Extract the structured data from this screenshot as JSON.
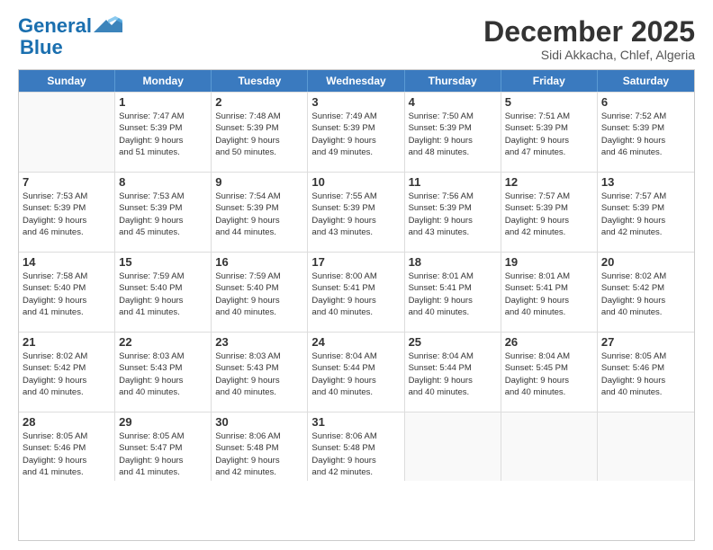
{
  "logo": {
    "line1": "General",
    "line2": "Blue"
  },
  "title": "December 2025",
  "location": "Sidi Akkacha, Chlef, Algeria",
  "days_of_week": [
    "Sunday",
    "Monday",
    "Tuesday",
    "Wednesday",
    "Thursday",
    "Friday",
    "Saturday"
  ],
  "weeks": [
    [
      {
        "num": "",
        "lines": []
      },
      {
        "num": "1",
        "lines": [
          "Sunrise: 7:47 AM",
          "Sunset: 5:39 PM",
          "Daylight: 9 hours",
          "and 51 minutes."
        ]
      },
      {
        "num": "2",
        "lines": [
          "Sunrise: 7:48 AM",
          "Sunset: 5:39 PM",
          "Daylight: 9 hours",
          "and 50 minutes."
        ]
      },
      {
        "num": "3",
        "lines": [
          "Sunrise: 7:49 AM",
          "Sunset: 5:39 PM",
          "Daylight: 9 hours",
          "and 49 minutes."
        ]
      },
      {
        "num": "4",
        "lines": [
          "Sunrise: 7:50 AM",
          "Sunset: 5:39 PM",
          "Daylight: 9 hours",
          "and 48 minutes."
        ]
      },
      {
        "num": "5",
        "lines": [
          "Sunrise: 7:51 AM",
          "Sunset: 5:39 PM",
          "Daylight: 9 hours",
          "and 47 minutes."
        ]
      },
      {
        "num": "6",
        "lines": [
          "Sunrise: 7:52 AM",
          "Sunset: 5:39 PM",
          "Daylight: 9 hours",
          "and 46 minutes."
        ]
      }
    ],
    [
      {
        "num": "7",
        "lines": [
          "Sunrise: 7:53 AM",
          "Sunset: 5:39 PM",
          "Daylight: 9 hours",
          "and 46 minutes."
        ]
      },
      {
        "num": "8",
        "lines": [
          "Sunrise: 7:53 AM",
          "Sunset: 5:39 PM",
          "Daylight: 9 hours",
          "and 45 minutes."
        ]
      },
      {
        "num": "9",
        "lines": [
          "Sunrise: 7:54 AM",
          "Sunset: 5:39 PM",
          "Daylight: 9 hours",
          "and 44 minutes."
        ]
      },
      {
        "num": "10",
        "lines": [
          "Sunrise: 7:55 AM",
          "Sunset: 5:39 PM",
          "Daylight: 9 hours",
          "and 43 minutes."
        ]
      },
      {
        "num": "11",
        "lines": [
          "Sunrise: 7:56 AM",
          "Sunset: 5:39 PM",
          "Daylight: 9 hours",
          "and 43 minutes."
        ]
      },
      {
        "num": "12",
        "lines": [
          "Sunrise: 7:57 AM",
          "Sunset: 5:39 PM",
          "Daylight: 9 hours",
          "and 42 minutes."
        ]
      },
      {
        "num": "13",
        "lines": [
          "Sunrise: 7:57 AM",
          "Sunset: 5:39 PM",
          "Daylight: 9 hours",
          "and 42 minutes."
        ]
      }
    ],
    [
      {
        "num": "14",
        "lines": [
          "Sunrise: 7:58 AM",
          "Sunset: 5:40 PM",
          "Daylight: 9 hours",
          "and 41 minutes."
        ]
      },
      {
        "num": "15",
        "lines": [
          "Sunrise: 7:59 AM",
          "Sunset: 5:40 PM",
          "Daylight: 9 hours",
          "and 41 minutes."
        ]
      },
      {
        "num": "16",
        "lines": [
          "Sunrise: 7:59 AM",
          "Sunset: 5:40 PM",
          "Daylight: 9 hours",
          "and 40 minutes."
        ]
      },
      {
        "num": "17",
        "lines": [
          "Sunrise: 8:00 AM",
          "Sunset: 5:41 PM",
          "Daylight: 9 hours",
          "and 40 minutes."
        ]
      },
      {
        "num": "18",
        "lines": [
          "Sunrise: 8:01 AM",
          "Sunset: 5:41 PM",
          "Daylight: 9 hours",
          "and 40 minutes."
        ]
      },
      {
        "num": "19",
        "lines": [
          "Sunrise: 8:01 AM",
          "Sunset: 5:41 PM",
          "Daylight: 9 hours",
          "and 40 minutes."
        ]
      },
      {
        "num": "20",
        "lines": [
          "Sunrise: 8:02 AM",
          "Sunset: 5:42 PM",
          "Daylight: 9 hours",
          "and 40 minutes."
        ]
      }
    ],
    [
      {
        "num": "21",
        "lines": [
          "Sunrise: 8:02 AM",
          "Sunset: 5:42 PM",
          "Daylight: 9 hours",
          "and 40 minutes."
        ]
      },
      {
        "num": "22",
        "lines": [
          "Sunrise: 8:03 AM",
          "Sunset: 5:43 PM",
          "Daylight: 9 hours",
          "and 40 minutes."
        ]
      },
      {
        "num": "23",
        "lines": [
          "Sunrise: 8:03 AM",
          "Sunset: 5:43 PM",
          "Daylight: 9 hours",
          "and 40 minutes."
        ]
      },
      {
        "num": "24",
        "lines": [
          "Sunrise: 8:04 AM",
          "Sunset: 5:44 PM",
          "Daylight: 9 hours",
          "and 40 minutes."
        ]
      },
      {
        "num": "25",
        "lines": [
          "Sunrise: 8:04 AM",
          "Sunset: 5:44 PM",
          "Daylight: 9 hours",
          "and 40 minutes."
        ]
      },
      {
        "num": "26",
        "lines": [
          "Sunrise: 8:04 AM",
          "Sunset: 5:45 PM",
          "Daylight: 9 hours",
          "and 40 minutes."
        ]
      },
      {
        "num": "27",
        "lines": [
          "Sunrise: 8:05 AM",
          "Sunset: 5:46 PM",
          "Daylight: 9 hours",
          "and 40 minutes."
        ]
      }
    ],
    [
      {
        "num": "28",
        "lines": [
          "Sunrise: 8:05 AM",
          "Sunset: 5:46 PM",
          "Daylight: 9 hours",
          "and 41 minutes."
        ]
      },
      {
        "num": "29",
        "lines": [
          "Sunrise: 8:05 AM",
          "Sunset: 5:47 PM",
          "Daylight: 9 hours",
          "and 41 minutes."
        ]
      },
      {
        "num": "30",
        "lines": [
          "Sunrise: 8:06 AM",
          "Sunset: 5:48 PM",
          "Daylight: 9 hours",
          "and 42 minutes."
        ]
      },
      {
        "num": "31",
        "lines": [
          "Sunrise: 8:06 AM",
          "Sunset: 5:48 PM",
          "Daylight: 9 hours",
          "and 42 minutes."
        ]
      },
      {
        "num": "",
        "lines": []
      },
      {
        "num": "",
        "lines": []
      },
      {
        "num": "",
        "lines": []
      }
    ]
  ]
}
